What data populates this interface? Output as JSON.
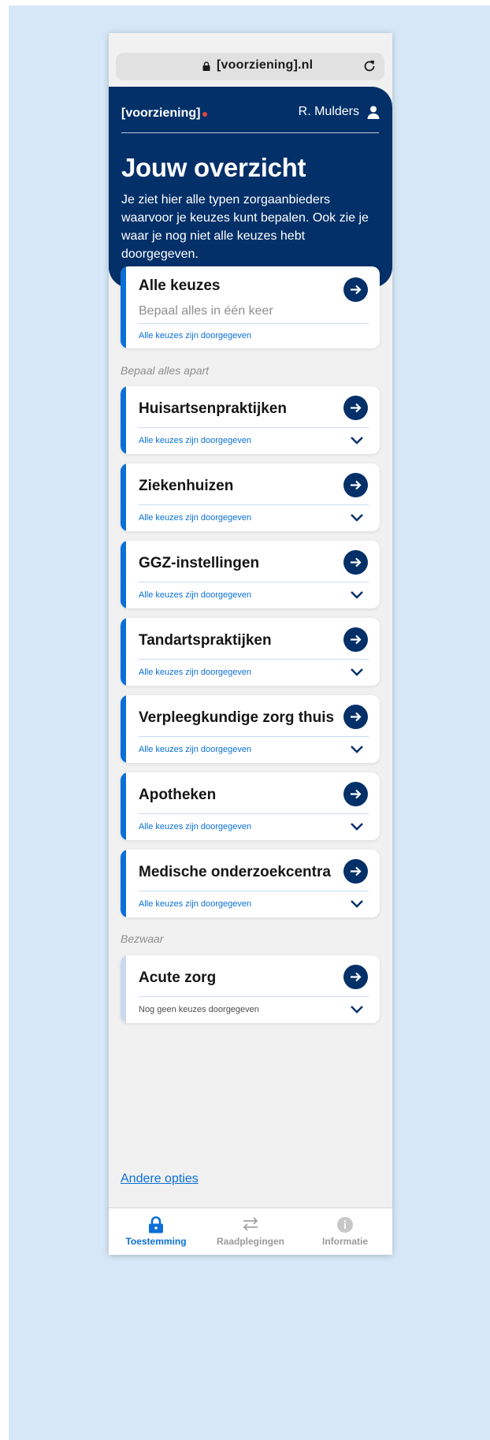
{
  "browser": {
    "url": "[voorziening].nl"
  },
  "header": {
    "brand": "[voorziening]",
    "user_name": "R. Mulders",
    "title": "Jouw overzicht",
    "intro": "Je ziet hier alle typen zorgaanbieders waarvoor je keuzes kunt bepalen. Ook zie je waar je nog niet alle keuzes hebt doorgegeven."
  },
  "all_choices": {
    "title": "Alle keuzes",
    "subtitle": "Bepaal alles in één keer",
    "status": "Alle keuzes zijn doorgegeven"
  },
  "section_separate": "Bepaal alles apart",
  "providers": [
    {
      "title": "Huisartsenpraktijken",
      "status": "Alle keuzes zijn doorgegeven"
    },
    {
      "title": "Ziekenhuizen",
      "status": "Alle keuzes zijn doorgegeven"
    },
    {
      "title": "GGZ-instellingen",
      "status": "Alle keuzes zijn doorgegeven"
    },
    {
      "title": "Tandartspraktijken",
      "status": "Alle keuzes zijn doorgegeven"
    },
    {
      "title": "Verpleegkundige zorg thuis",
      "status": "Alle keuzes zijn doorgegeven"
    },
    {
      "title": "Apotheken",
      "status": "Alle keuzes zijn doorgegeven"
    },
    {
      "title": "Medische onderzoekcentra",
      "status": "Alle keuzes zijn doorgegeven"
    }
  ],
  "section_objection": "Bezwaar",
  "objection": {
    "title": "Acute zorg",
    "status": "Nog geen keuzes doorgegeven"
  },
  "other_options": "Andere opties",
  "bottom_nav": [
    {
      "label": "Toestemming",
      "icon": "lock-icon",
      "active": true
    },
    {
      "label": "Raadplegingen",
      "icon": "swap-arrows-icon",
      "active": false
    },
    {
      "label": "Informatie",
      "icon": "info-icon",
      "active": false
    }
  ],
  "colors": {
    "primary_navy": "#033069",
    "accent_blue": "#0a6fd6",
    "brand_dot": "#e0463f",
    "backdrop": "#d6e8f7"
  }
}
